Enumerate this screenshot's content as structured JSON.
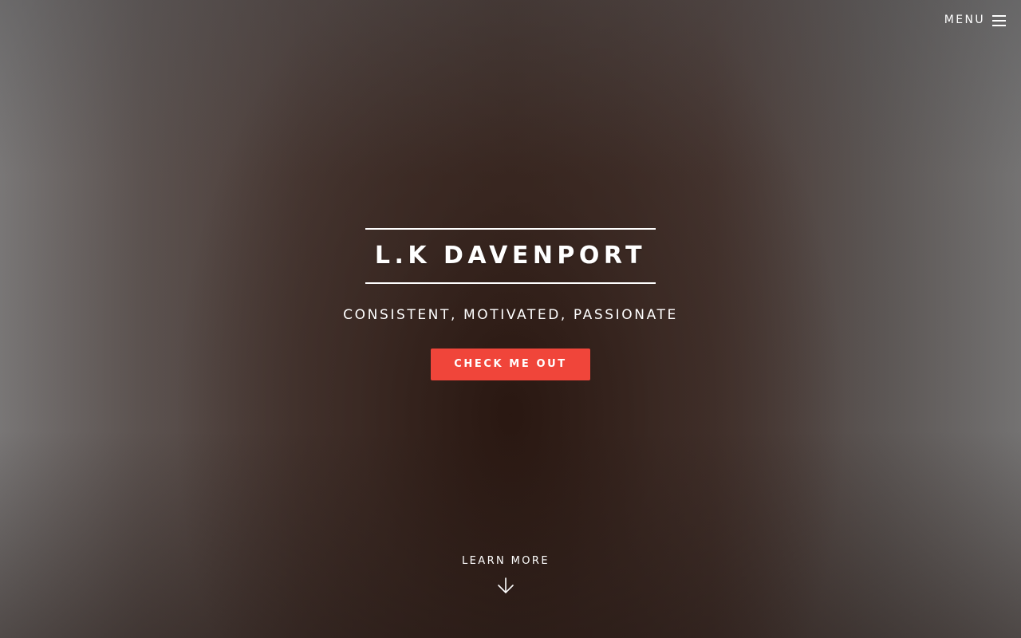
{
  "header": {
    "menu_label": "MENU",
    "menu_icon": "hamburger-icon"
  },
  "hero": {
    "title": "L.K DAVENPORT",
    "tagline": "CONSISTENT, MOTIVATED, PASSIONATE",
    "cta_label": "CHECK ME OUT"
  },
  "footer": {
    "learn_more_label": "LEARN MORE",
    "learn_more_icon": "arrow-down-icon"
  },
  "colors": {
    "accent": "#f0453a",
    "text": "#ffffff"
  }
}
